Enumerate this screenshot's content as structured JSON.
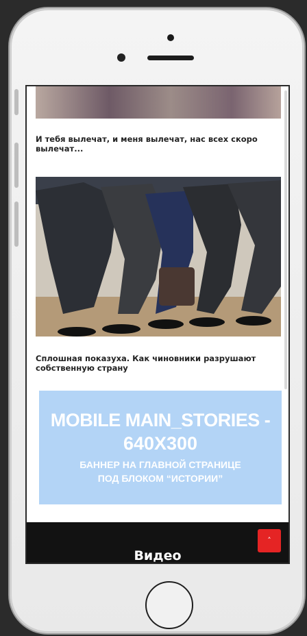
{
  "feed": {
    "item1": {
      "caption": "И тебя вылечат, и меня вылечат, нас всех скоро вылечат..."
    },
    "item2": {
      "caption": "Сплошная показуха. Как чиновники разрушают собственную страну"
    }
  },
  "banner": {
    "line1": "MOBILE MAIN_STORIES  -",
    "line2": "640X300",
    "line3": "БАННЕР НА ГЛАВНОЙ СТРАНИЦЕ",
    "line4": "ПОД БЛОКОМ “ИСТОРИИ”",
    "bg_color": "#b3d4f6"
  },
  "video_section": {
    "title": "Видео",
    "scroll_top_icon": "chevron-up-icon",
    "scroll_top_glyph": "˄",
    "accent_color": "#e52424"
  }
}
